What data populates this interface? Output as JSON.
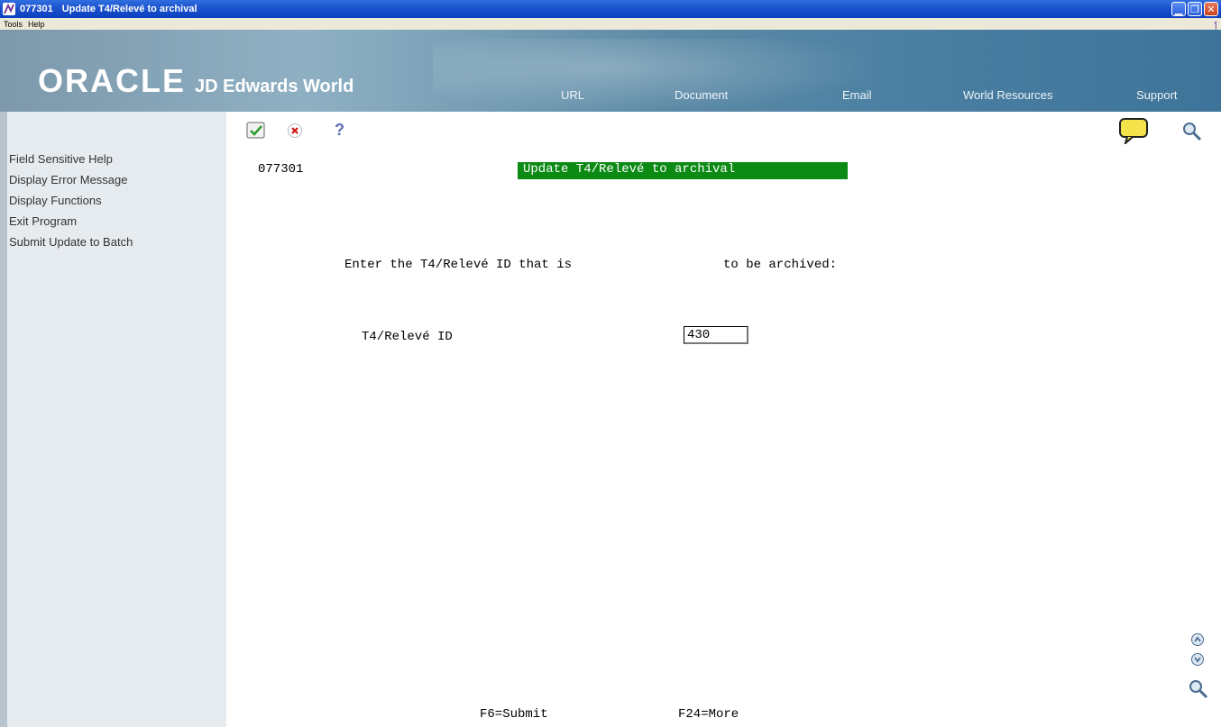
{
  "window": {
    "program_id": "077301",
    "title": "Update T4/Relevé to archival",
    "buttons": [
      "minimize",
      "maximize",
      "close"
    ]
  },
  "menubar": {
    "items": [
      "Tools",
      "Help"
    ]
  },
  "banner": {
    "brand": "ORACLE",
    "product": "JD Edwards World",
    "nav": [
      "URL",
      "Document",
      "Email",
      "World Resources",
      "Support"
    ]
  },
  "sidebar": {
    "items": [
      "Field Sensitive Help",
      "Display Error Message",
      "Display Functions",
      "Exit Program",
      "Submit Update to Batch"
    ]
  },
  "toolbar": {
    "icons": [
      "check-icon",
      "cancel-icon",
      "help-icon",
      "message-icon",
      "search-icon"
    ]
  },
  "form": {
    "program_id": "077301",
    "title": "Update T4/Relevé to archival",
    "instruction_left": "Enter the T4/Relevé ID that is",
    "instruction_right": "to be archived:",
    "field_label": "T4/Relevé ID",
    "field_value": "430"
  },
  "function_keys": [
    "F6=Submit",
    "F24=More"
  ],
  "colors": {
    "title_green": "#0b8a14",
    "sidebar_bg": "#e6ebf0"
  }
}
